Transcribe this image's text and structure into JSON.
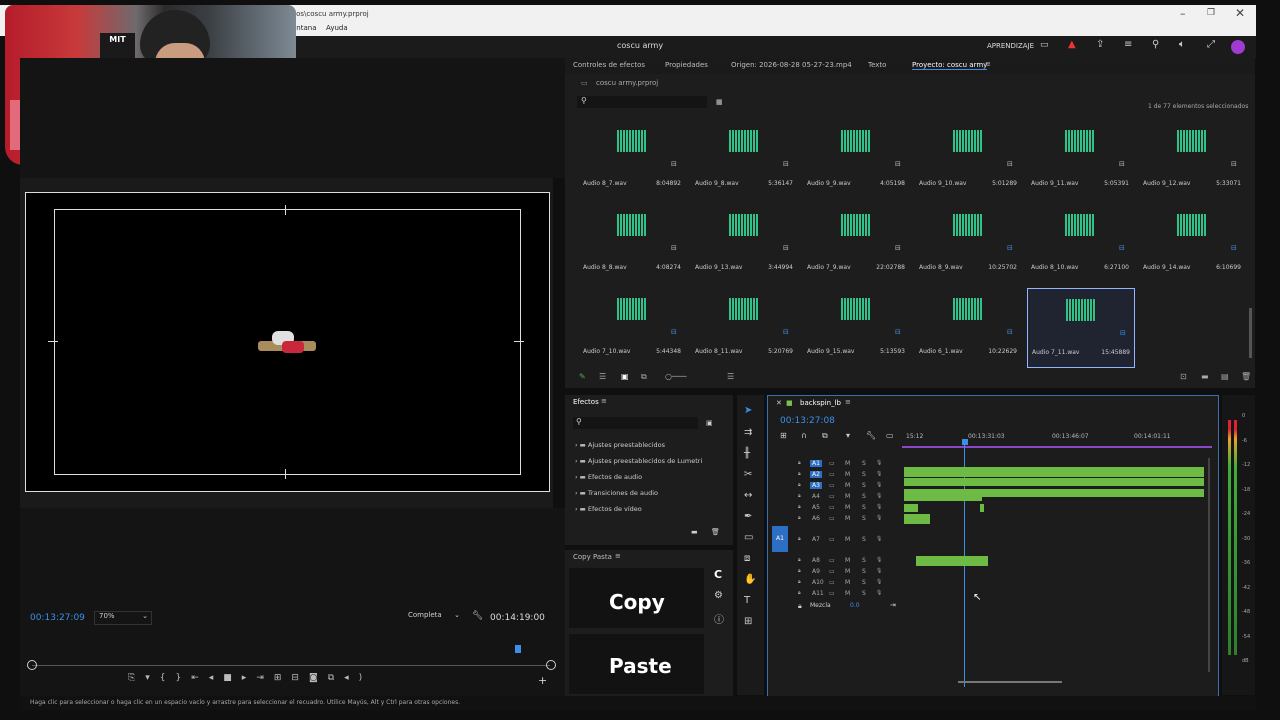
{
  "window": {
    "title": "vos\\coscu army.prproj",
    "menu": [
      "entana",
      "Ayuda"
    ],
    "project_name": "coscu army",
    "workspace": "APRENDIZAJE"
  },
  "webcam": {
    "logo_text": "MIT"
  },
  "source_panel": {
    "tabs": [
      "Controles de efectos",
      "Propiedades",
      "Origen: 2026-08-28 05-27-23.mp4",
      "Texto",
      "Proyecto: coscu army"
    ],
    "project_file": "coscu army.prproj",
    "selection_status": "1 de 77 elementos seleccionados",
    "items": [
      {
        "name": "Audio 8_7.wav",
        "duration": "8:04892"
      },
      {
        "name": "Audio 9_8.wav",
        "duration": "5:36147"
      },
      {
        "name": "Audio 9_9.wav",
        "duration": "4:05198"
      },
      {
        "name": "Audio 9_10.wav",
        "duration": "5:01289"
      },
      {
        "name": "Audio 9_11.wav",
        "duration": "5:05391"
      },
      {
        "name": "Audio 9_12.wav",
        "duration": "5:33071"
      },
      {
        "name": "Audio 8_8.wav",
        "duration": "4:08274"
      },
      {
        "name": "Audio 9_13.wav",
        "duration": "3:44994"
      },
      {
        "name": "Audio 7_9.wav",
        "duration": "22:02788"
      },
      {
        "name": "Audio 8_9.wav",
        "duration": "10:25702"
      },
      {
        "name": "Audio 8_10.wav",
        "duration": "6:27100"
      },
      {
        "name": "Audio 9_14.wav",
        "duration": "6:10699"
      },
      {
        "name": "Audio 7_10.wav",
        "duration": "5:44348"
      },
      {
        "name": "Audio 8_11.wav",
        "duration": "5:20769"
      },
      {
        "name": "Audio 9_15.wav",
        "duration": "5:13593"
      },
      {
        "name": "Audio 6_1.wav",
        "duration": "10:22629"
      },
      {
        "name": "Audio 7_11.wav",
        "duration": "15:45889"
      }
    ]
  },
  "program_monitor": {
    "current_time": "00:13:27:09",
    "zoom": "70%",
    "quality": "Completa",
    "duration": "00:14:19:00"
  },
  "effects_panel": {
    "title": "Efectos",
    "folders": [
      "Ajustes preestablecidos",
      "Ajustes preestablecidos de Lumetri",
      "Efectos de audio",
      "Transiciones de audio",
      "Efectos de vídeo"
    ]
  },
  "copy_panel": {
    "title": "Copy Pasta",
    "copy": "Copy",
    "paste": "Paste",
    "c_icon_label": "C"
  },
  "timeline": {
    "sequence": "backspin_lb",
    "timecode": "00:13:27:08",
    "ruler": [
      "15:12",
      "00:13:31:03",
      "00:13:46:07",
      "00:14:01:11"
    ],
    "tracks": [
      "A1",
      "A2",
      "A3",
      "A4",
      "A5",
      "A6",
      "A7",
      "A8",
      "A9",
      "A10",
      "A11"
    ],
    "mix_label": "Mezcla",
    "mix_value": "0.0",
    "source_patch": "A1"
  },
  "vu_meter": {
    "labels": [
      "0",
      "-6",
      "-12",
      "-18",
      "-24",
      "-30",
      "-36",
      "-42",
      "-48",
      "-54",
      "dB"
    ]
  },
  "status_bar": "Haga clic para seleccionar o haga clic en un espacio vacío y arrastre para seleccionar el recuadro. Utilice Mayús, Alt y Ctrl para otras opciones."
}
